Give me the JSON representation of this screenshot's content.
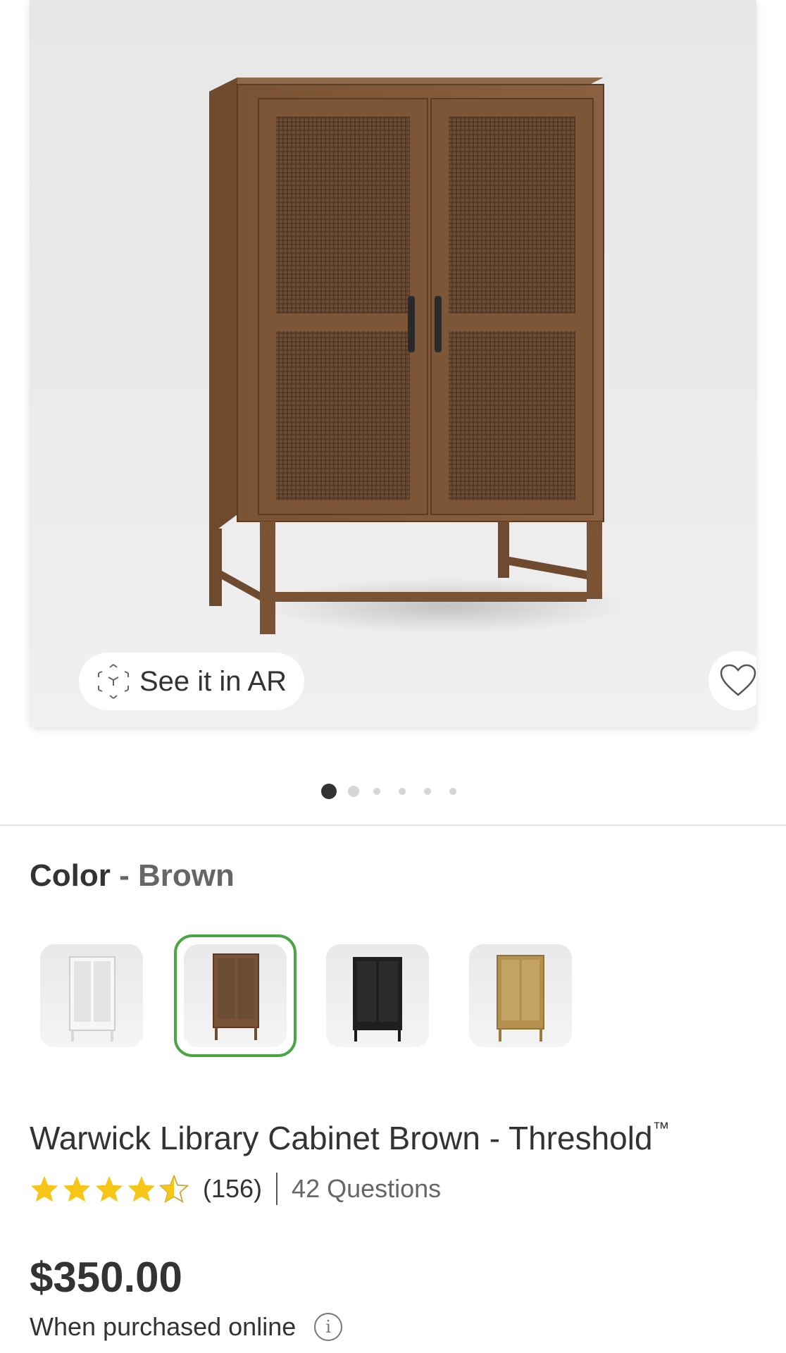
{
  "product_image": {
    "ar_button_label": "See it in AR",
    "carousel": {
      "total": 6,
      "active_index": 0
    }
  },
  "color": {
    "label": "Color",
    "separator": "-",
    "selected": "Brown",
    "swatches": [
      {
        "name": "White",
        "color": "#f2f2f2",
        "selected": false
      },
      {
        "name": "Brown",
        "color": "#7a5236",
        "selected": true
      },
      {
        "name": "Black",
        "color": "#1f1f1f",
        "selected": false
      },
      {
        "name": "Natural",
        "color": "#b4904f",
        "selected": false
      }
    ]
  },
  "product": {
    "title": "Warwick Library Cabinet Brown - Threshold",
    "trademark": "™",
    "rating": 4.5,
    "review_count": "(156)",
    "questions": "42 Questions",
    "price": "$350.00",
    "price_note": "When purchased online"
  },
  "colors": {
    "accent_selected": "#4aa642",
    "star": "#f5c518",
    "text": "#333333"
  }
}
